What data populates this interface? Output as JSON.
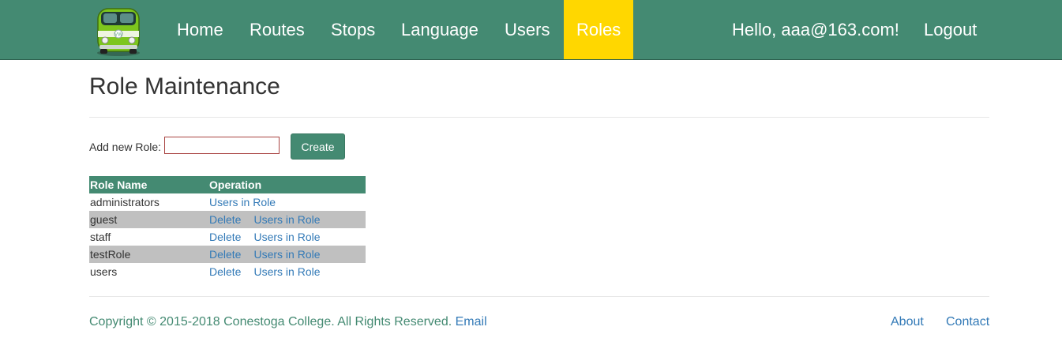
{
  "brand": {
    "logo_icon": "green-van-icon",
    "logo_color": "#7dc61d"
  },
  "colors": {
    "navbar": "#448a72",
    "active_tab": "#ffd700",
    "link": "#337ab7",
    "alt_row": "#c0c0c0"
  },
  "nav": {
    "items": [
      {
        "label": "Home"
      },
      {
        "label": "Routes"
      },
      {
        "label": "Stops"
      },
      {
        "label": "Language"
      },
      {
        "label": "Users"
      },
      {
        "label": "Roles",
        "active": true
      }
    ],
    "greeting": "Hello, aaa@163.com!",
    "logout": "Logout"
  },
  "page": {
    "title": "Role Maintenance",
    "add_label": "Add new Role:",
    "add_input": {
      "value": "",
      "placeholder": ""
    },
    "create_label": "Create"
  },
  "table": {
    "headers": [
      "Role Name",
      "Operation"
    ],
    "delete_label": "Delete",
    "users_label": "Users in Role",
    "rows": [
      {
        "name": "administrators",
        "ops": [
          "Users in Role"
        ]
      },
      {
        "name": "guest",
        "ops": [
          "Delete",
          "Users in Role"
        ]
      },
      {
        "name": "staff",
        "ops": [
          "Delete",
          "Users in Role"
        ]
      },
      {
        "name": "testRole",
        "ops": [
          "Delete",
          "Users in Role"
        ]
      },
      {
        "name": "users",
        "ops": [
          "Delete",
          "Users in Role"
        ]
      }
    ]
  },
  "footer": {
    "copyright": "Copyright © 2015-2018 Conestoga College. All Rights Reserved.",
    "email": "Email",
    "about": "About",
    "contact": "Contact"
  }
}
